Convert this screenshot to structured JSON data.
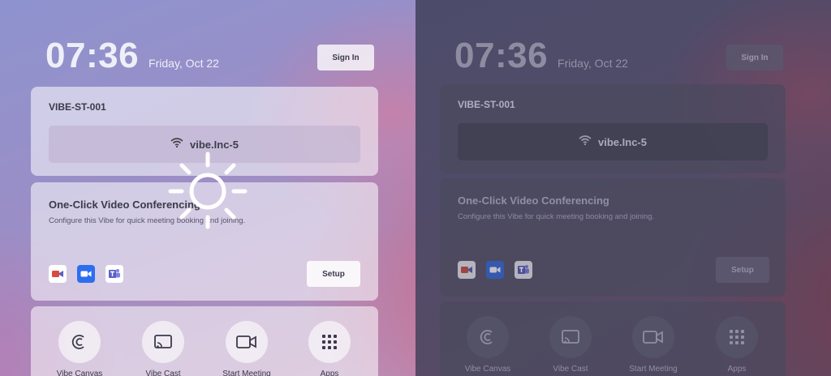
{
  "light": {
    "time": "07:36",
    "date": "Friday, Oct 22",
    "sign_in_label": "Sign In",
    "device_name": "VIBE-ST-001",
    "wifi_network": "vibe.Inc-5",
    "conferencing": {
      "title": "One-Click Video Conferencing",
      "description": "Configure this Vibe for quick meeting booking and joining.",
      "setup_label": "Setup",
      "apps": [
        "Microsoft Teams Rooms",
        "Zoom",
        "Microsoft Teams"
      ]
    },
    "quick_apps": [
      "Vibe Canvas",
      "Vibe Cast",
      "Start Meeting",
      "Apps"
    ],
    "mode_icon": "sun-icon"
  },
  "dark": {
    "time": "07:36",
    "date": "Friday, Oct 22",
    "sign_in_label": "Sign In",
    "device_name": "VIBE-ST-001",
    "wifi_network": "vibe.Inc-5",
    "conferencing": {
      "title": "One-Click Video Conferencing",
      "description": "Configure this Vibe for quick meeting booking and joining.",
      "setup_label": "Setup",
      "apps": [
        "Microsoft Teams Rooms",
        "Zoom",
        "Microsoft Teams"
      ]
    },
    "quick_apps": [
      "Vibe Canvas",
      "Vibe Cast",
      "Start Meeting",
      "Apps"
    ],
    "mode_icon": "moon-icon"
  },
  "colors": {
    "zoom_blue": "#2d6ef0",
    "teams_purple": "#5b5fc7",
    "mtr_red": "#d94a3f"
  }
}
